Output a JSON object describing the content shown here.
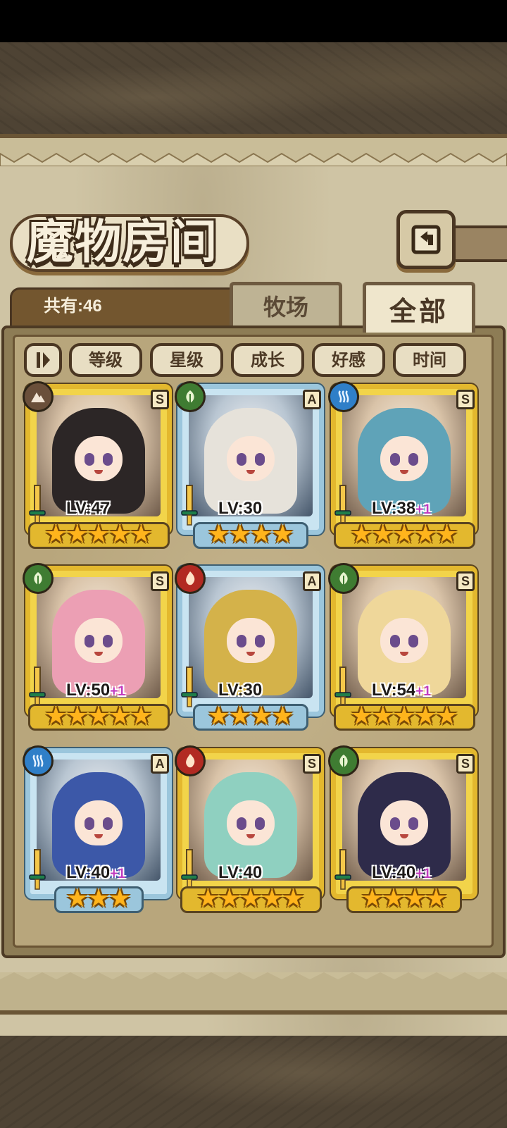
{
  "header": {
    "title": "魔物房间",
    "count_label": "共有:46"
  },
  "tabs": [
    {
      "label": "牧场",
      "active": false
    },
    {
      "label": "全部",
      "active": true
    }
  ],
  "sort": {
    "toggle_icon": "sort-order-icon",
    "buttons": [
      "等级",
      "星级",
      "成长",
      "好感",
      "时间"
    ]
  },
  "monsters": [
    {
      "element": "earth",
      "rank": "S",
      "level": "LV:47",
      "plus": "",
      "stars": 5,
      "hair": "#2c2626"
    },
    {
      "element": "wood",
      "rank": "A",
      "level": "LV:30",
      "plus": "",
      "stars": 4,
      "hair": "#e6e2da"
    },
    {
      "element": "water",
      "rank": "S",
      "level": "LV:38",
      "plus": "+1",
      "stars": 5,
      "hair": "#5fa3b8"
    },
    {
      "element": "wood",
      "rank": "S",
      "level": "LV:50",
      "plus": "+1",
      "stars": 5,
      "hair": "#ec9fb4"
    },
    {
      "element": "fire",
      "rank": "A",
      "level": "LV:30",
      "plus": "",
      "stars": 4,
      "hair": "#d4b24a"
    },
    {
      "element": "wood",
      "rank": "S",
      "level": "LV:54",
      "plus": "+1",
      "stars": 5,
      "hair": "#efd79a"
    },
    {
      "element": "water",
      "rank": "A",
      "level": "LV:40",
      "plus": "+1",
      "stars": 3,
      "hair": "#3c58a8"
    },
    {
      "element": "fire",
      "rank": "S",
      "level": "LV:40",
      "plus": "",
      "stars": 5,
      "hair": "#8fd0c0"
    },
    {
      "element": "wood",
      "rank": "S",
      "level": "LV:40",
      "plus": "+1",
      "stars": 4,
      "hair": "#2e2b4a"
    }
  ],
  "colors": {
    "gold_frame": "#e3b82e",
    "silver_frame": "#9bc6dc",
    "plus_color": "#c13bbf"
  }
}
